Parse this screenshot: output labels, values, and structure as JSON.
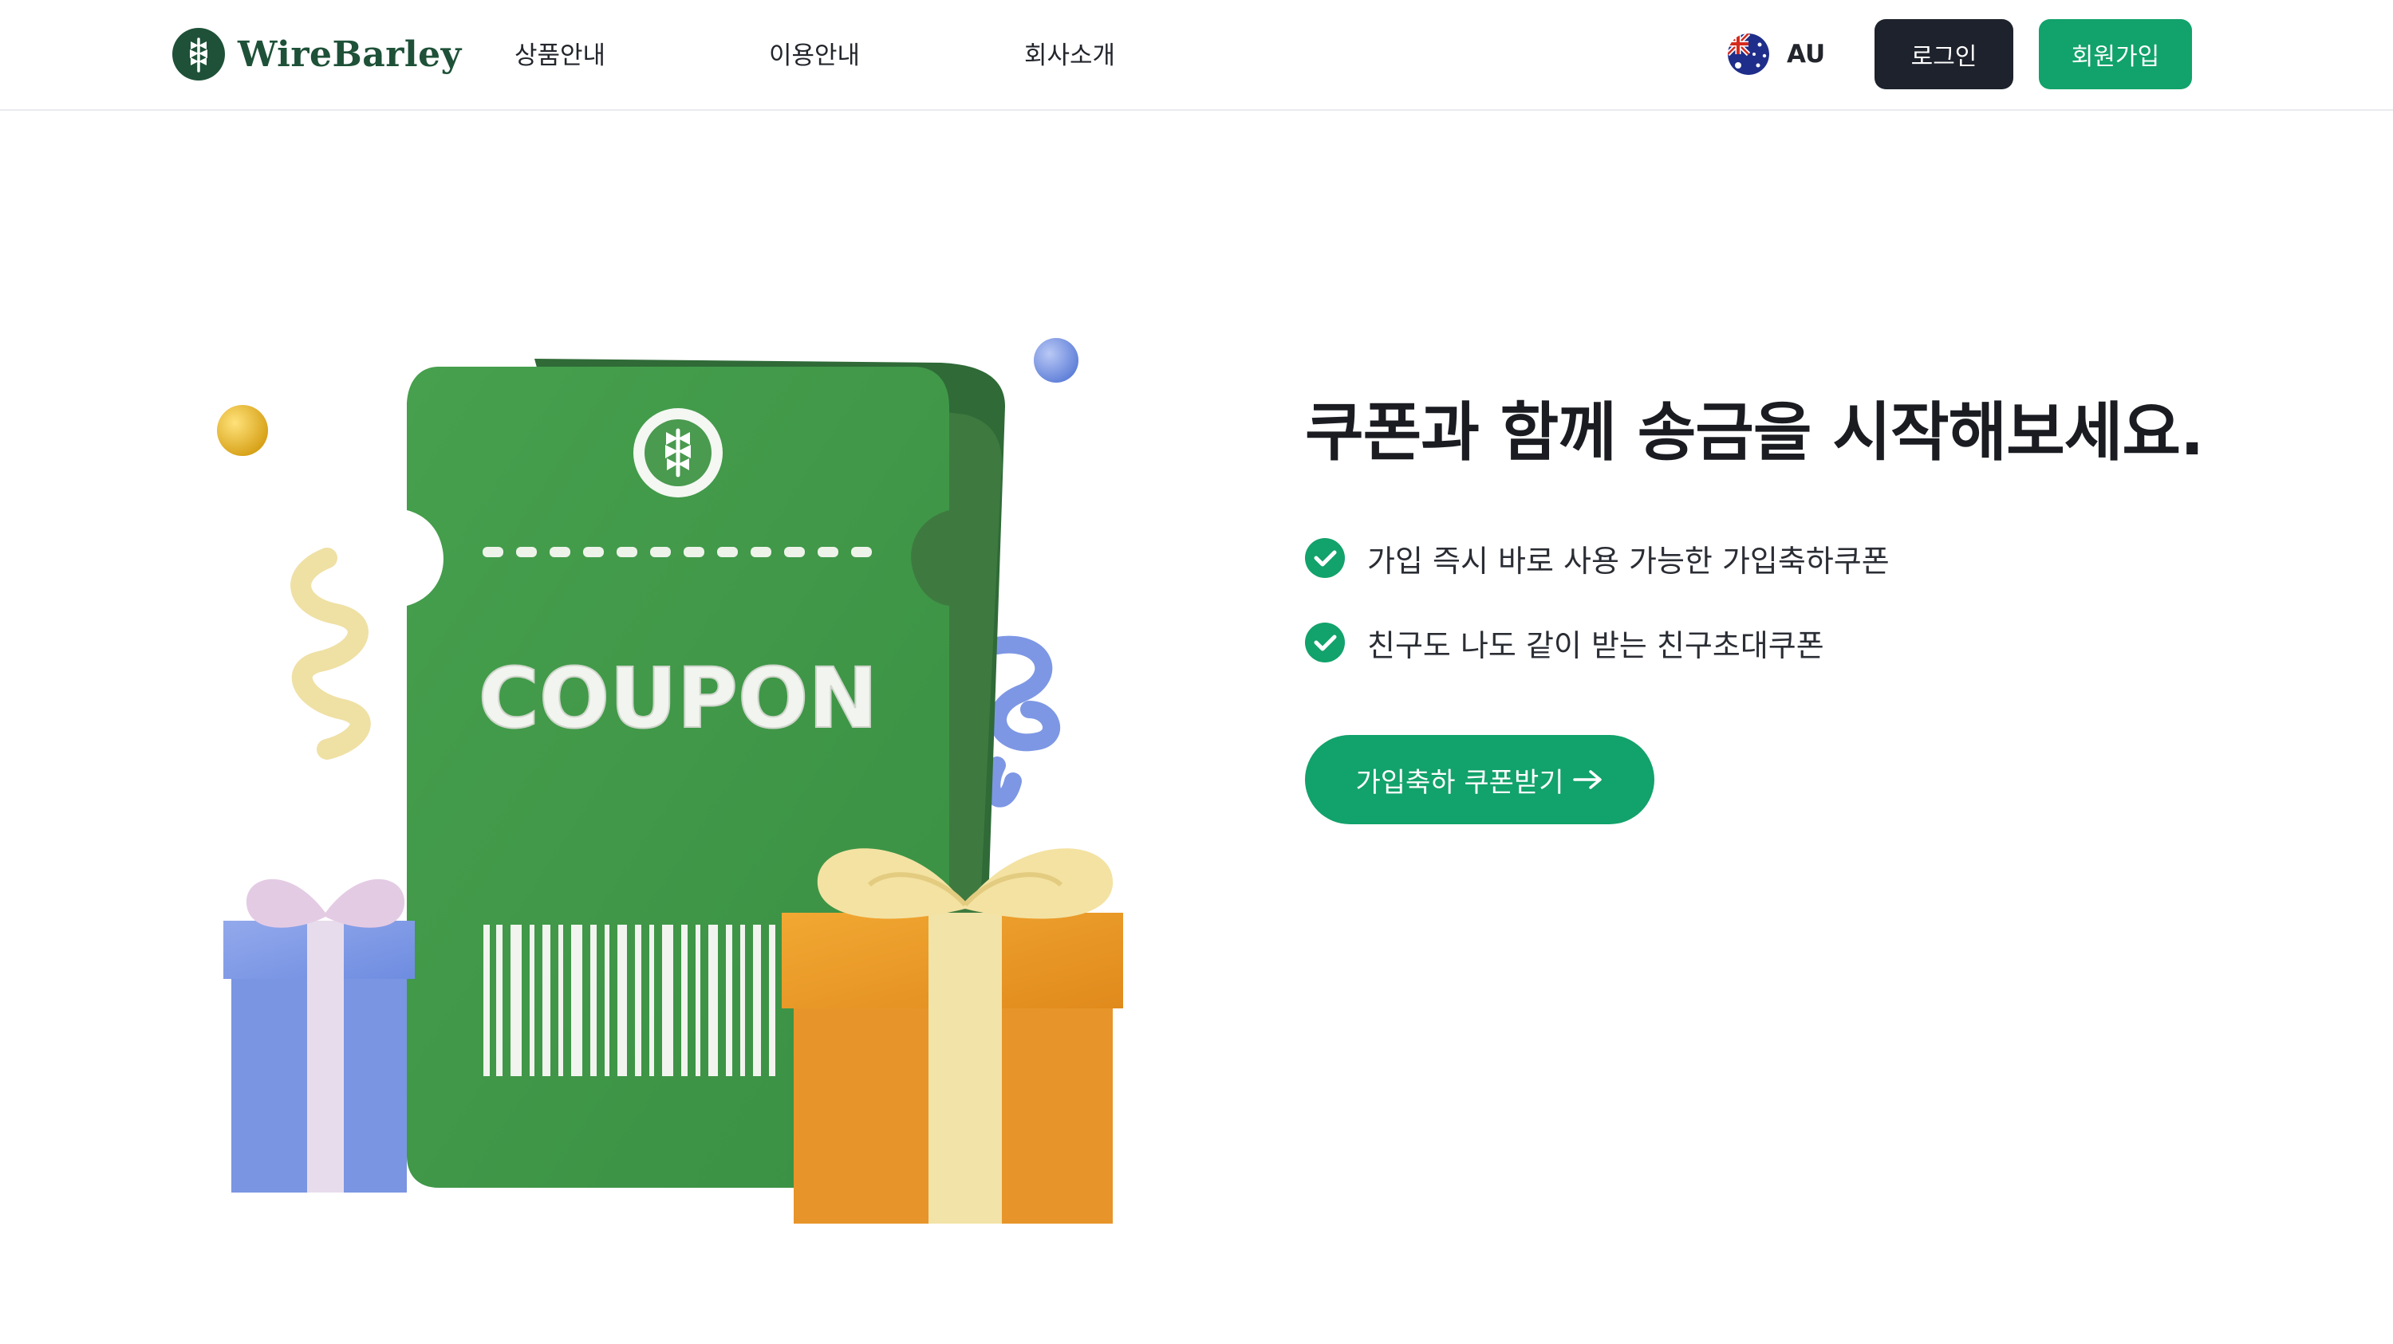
{
  "brand": {
    "name": "WireBarley",
    "icon": "barley-logo-icon"
  },
  "nav": {
    "items": [
      {
        "label": "상품안내"
      },
      {
        "label": "이용안내"
      },
      {
        "label": "회사소개"
      }
    ]
  },
  "region": {
    "code": "AU",
    "flag_icon": "australia-flag-icon"
  },
  "auth": {
    "login_label": "로그인",
    "signup_label": "회원가입"
  },
  "hero": {
    "headline": "쿠폰과 함께 송금을 시작해보세요.",
    "benefits": [
      {
        "text": "가입 즉시 바로 사용 가능한 가입축하쿠폰",
        "icon": "check-circle-icon"
      },
      {
        "text": "친구도 나도 같이 받는 친구초대쿠폰",
        "icon": "check-circle-icon"
      }
    ],
    "cta_label": "가입축하 쿠폰받기",
    "cta_icon": "arrow-right-icon",
    "illustration": {
      "coupon_text": "COUPON"
    }
  },
  "colors": {
    "brand_green": "#1e5138",
    "accent_green": "#12a26b",
    "coupon_green": "#3f9a48",
    "dark_button": "#1e222c",
    "text": "#1a1c22"
  }
}
